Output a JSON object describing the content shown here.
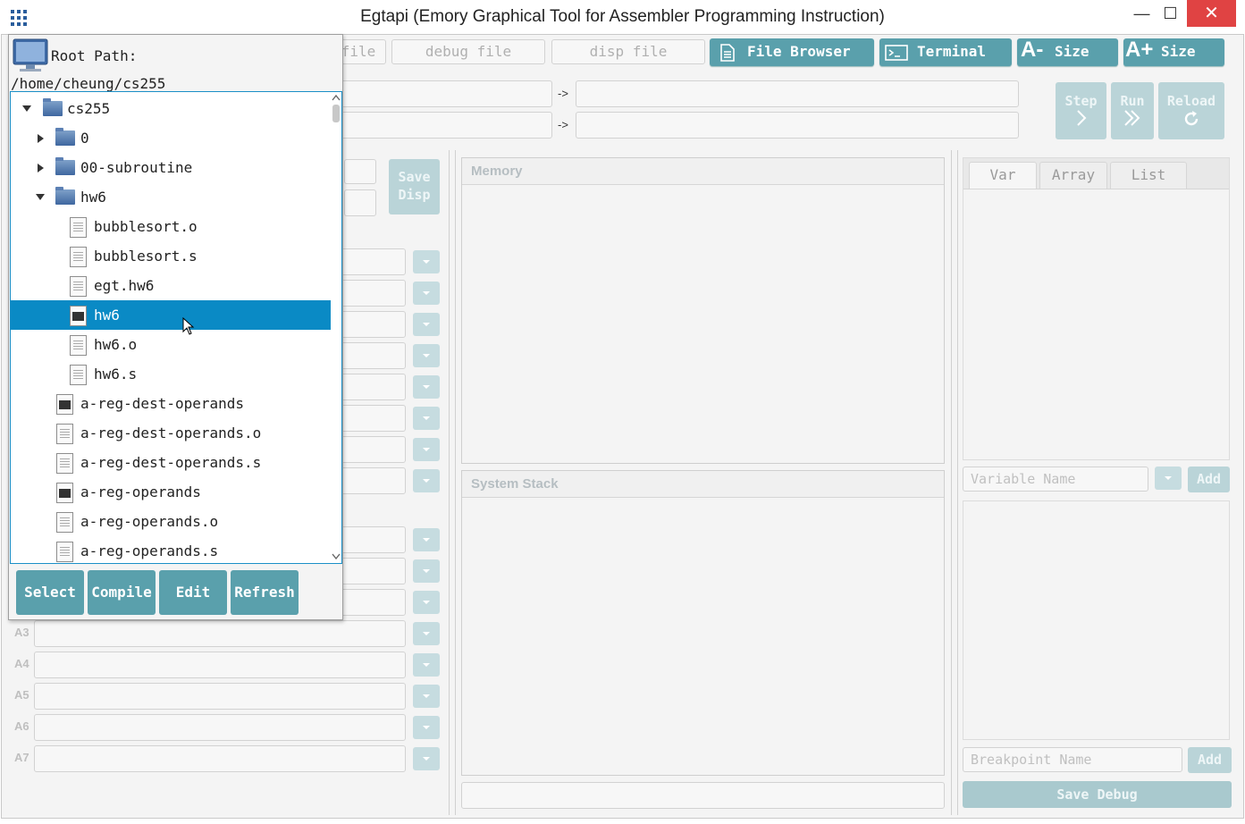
{
  "window": {
    "title": "Egtapi (Emory Graphical Tool for Assembler Programming Instruction)",
    "minimize": "—",
    "maximize": "☐",
    "close": "✕"
  },
  "toolbar": {
    "file_input_partial": "file",
    "debug_file_placeholder": "debug file",
    "disp_file_placeholder": "disp file",
    "file_browser": "File Browser",
    "terminal": "Terminal",
    "size_minus_glyph": "A-",
    "size_plus_glyph": "A+",
    "size_label": "Size"
  },
  "controls": {
    "arrow": "->",
    "step": "Step",
    "run": "Run",
    "reload": "Reload"
  },
  "left_panel": {
    "save_disp_line1": "Save",
    "save_disp_line2": "Disp",
    "register_labels": [
      "A3",
      "A4",
      "A5",
      "A6",
      "A7"
    ]
  },
  "center_panel": {
    "memory_title": "Memory",
    "stack_title": "System Stack"
  },
  "right_panel": {
    "tabs": [
      "Var",
      "Array",
      "List"
    ],
    "variable_placeholder": "Variable Name",
    "add_var": "Add",
    "breakpoint_placeholder": "Breakpoint Name",
    "add_bp": "Add",
    "save_debug": "Save Debug"
  },
  "file_browser": {
    "root_label": "Root Path:",
    "root_path": "/home/cheung/cs255",
    "tree": [
      {
        "label": "cs255",
        "type": "folder",
        "expanded": true,
        "level": 0
      },
      {
        "label": "0",
        "type": "folder",
        "expanded": false,
        "level": 1
      },
      {
        "label": "00-subroutine",
        "type": "folder",
        "expanded": false,
        "level": 1
      },
      {
        "label": "hw6",
        "type": "folder",
        "expanded": true,
        "level": 1
      },
      {
        "label": "bubblesort.o",
        "type": "file",
        "level": 2
      },
      {
        "label": "bubblesort.s",
        "type": "file",
        "level": 2
      },
      {
        "label": "egt.hw6",
        "type": "file",
        "level": 2
      },
      {
        "label": "hw6",
        "type": "exe",
        "level": 2,
        "selected": true
      },
      {
        "label": "hw6.o",
        "type": "file",
        "level": 2
      },
      {
        "label": "hw6.s",
        "type": "file",
        "level": 2
      },
      {
        "label": "a-reg-dest-operands",
        "type": "exe",
        "level": 1
      },
      {
        "label": "a-reg-dest-operands.o",
        "type": "file",
        "level": 1
      },
      {
        "label": "a-reg-dest-operands.s",
        "type": "file",
        "level": 1
      },
      {
        "label": "a-reg-operands",
        "type": "exe",
        "level": 1
      },
      {
        "label": "a-reg-operands.o",
        "type": "file",
        "level": 1
      },
      {
        "label": "a-reg-operands.s",
        "type": "file",
        "level": 1
      }
    ],
    "buttons": {
      "select": "Select",
      "compile": "Compile",
      "edit": "Edit",
      "refresh": "Refresh"
    }
  },
  "colors": {
    "accent": "#5aa0ac",
    "selection": "#0a8ac5",
    "close_button": "#e04343"
  }
}
